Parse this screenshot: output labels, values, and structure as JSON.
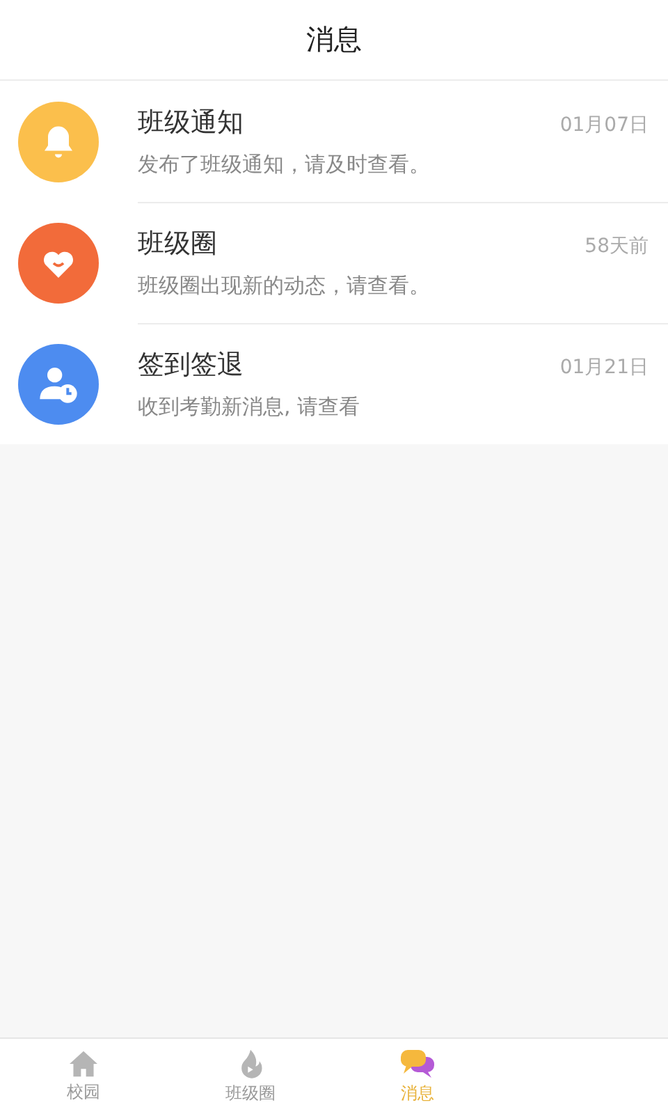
{
  "header": {
    "title": "消息"
  },
  "messages": [
    {
      "kind": "bell",
      "color": "#fbbf4c",
      "title": "班级通知",
      "time": "01月07日",
      "preview": "发布了班级通知，请及时查看。"
    },
    {
      "kind": "heart",
      "color": "#f26b3a",
      "title": "班级圈",
      "time": "58天前",
      "preview": "班级圈出现新的动态，请查看。"
    },
    {
      "kind": "attendance",
      "color": "#4d8cf0",
      "title": "签到签退",
      "time": "01月21日",
      "preview": "收到考勤新消息, 请查看"
    }
  ],
  "tabs": [
    {
      "kind": "home",
      "label": "校园",
      "selected": false
    },
    {
      "kind": "flame",
      "label": "班级圈",
      "selected": false
    },
    {
      "kind": "chat",
      "label": "消息",
      "selected": true
    }
  ]
}
